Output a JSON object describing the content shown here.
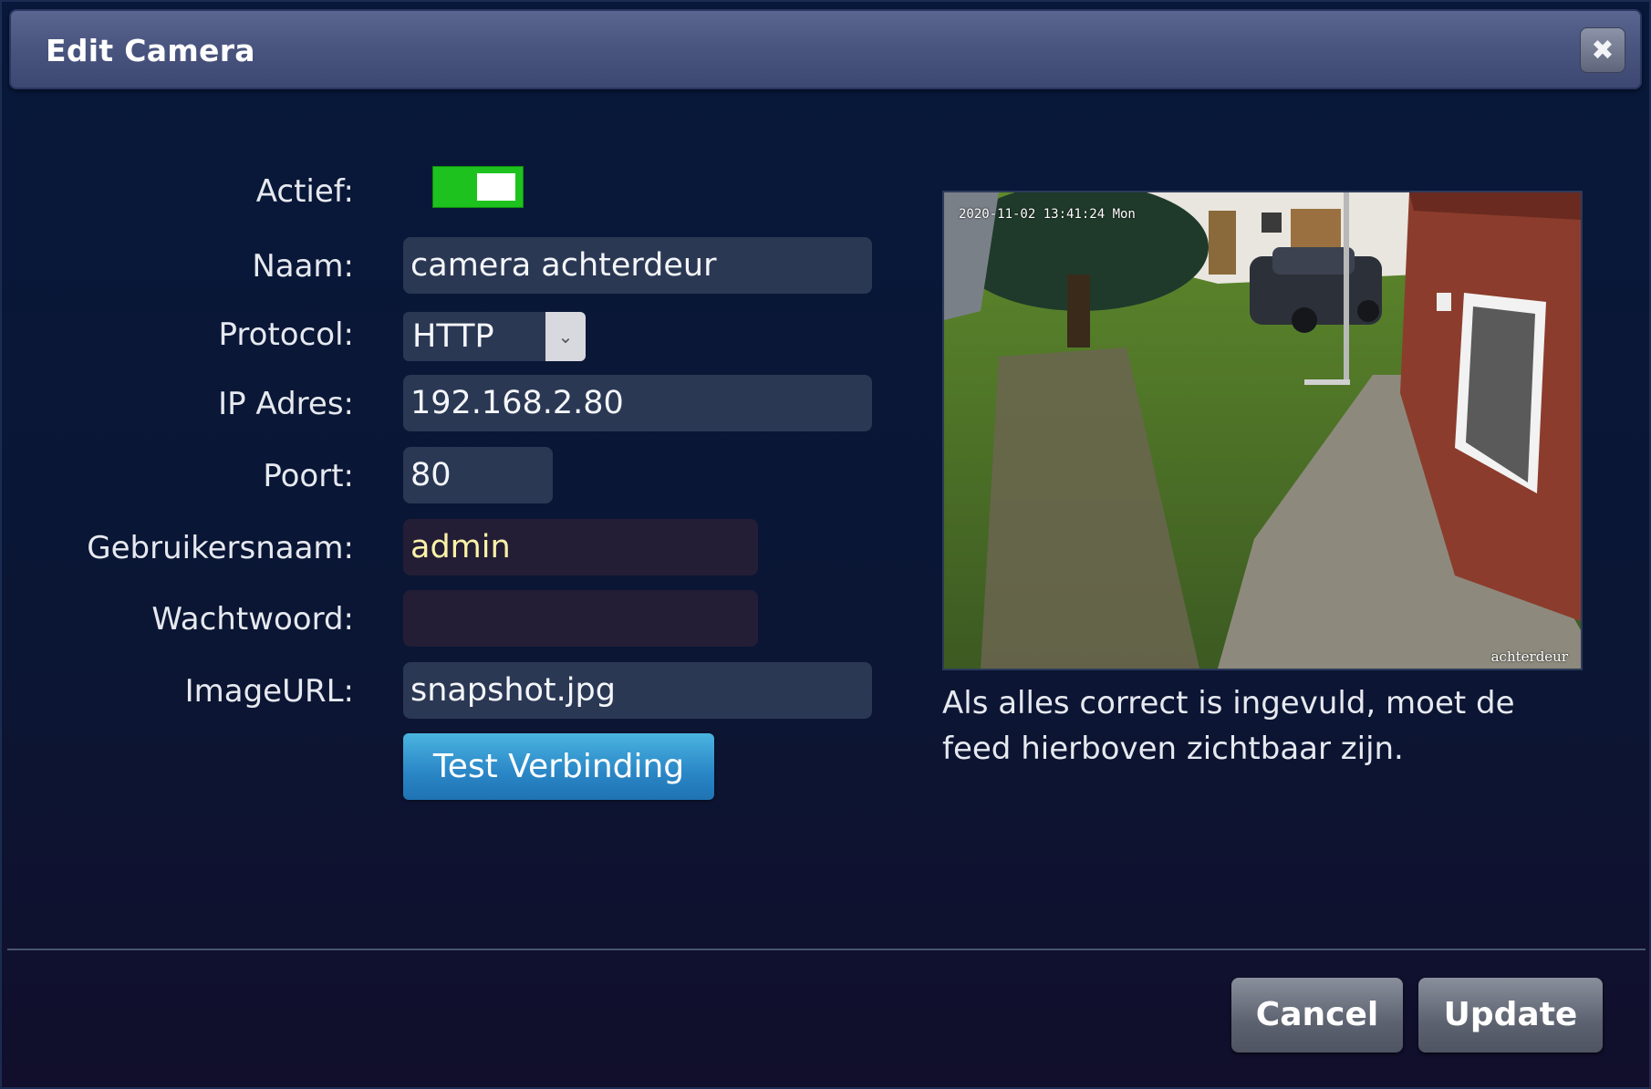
{
  "dialog": {
    "title": "Edit Camera",
    "close_icon": "close-icon"
  },
  "form": {
    "actief": {
      "label": "Actief:",
      "enabled": true,
      "color": "#1ec21e"
    },
    "naam": {
      "label": "Naam:",
      "value": "camera achterdeur"
    },
    "protocol": {
      "label": "Protocol:",
      "value": "HTTP"
    },
    "ip": {
      "label": "IP Adres:",
      "value": "192.168.2.80"
    },
    "poort": {
      "label": "Poort:",
      "value": "80"
    },
    "gebruikersnaam": {
      "label": "Gebruikersnaam:",
      "value": "admin"
    },
    "wachtwoord": {
      "label": "Wachtwoord:",
      "value": ""
    },
    "imageurl": {
      "label": "ImageURL:",
      "value": "snapshot.jpg"
    },
    "test_button": "Test Verbinding"
  },
  "preview": {
    "timestamp": "2020-11-02 13:41:24 Mon",
    "camera_name": "achterdeur",
    "hint": "Als alles correct is ingevuld, moet de feed hierboven zichtbaar zijn."
  },
  "footer": {
    "cancel": "Cancel",
    "update": "Update"
  }
}
